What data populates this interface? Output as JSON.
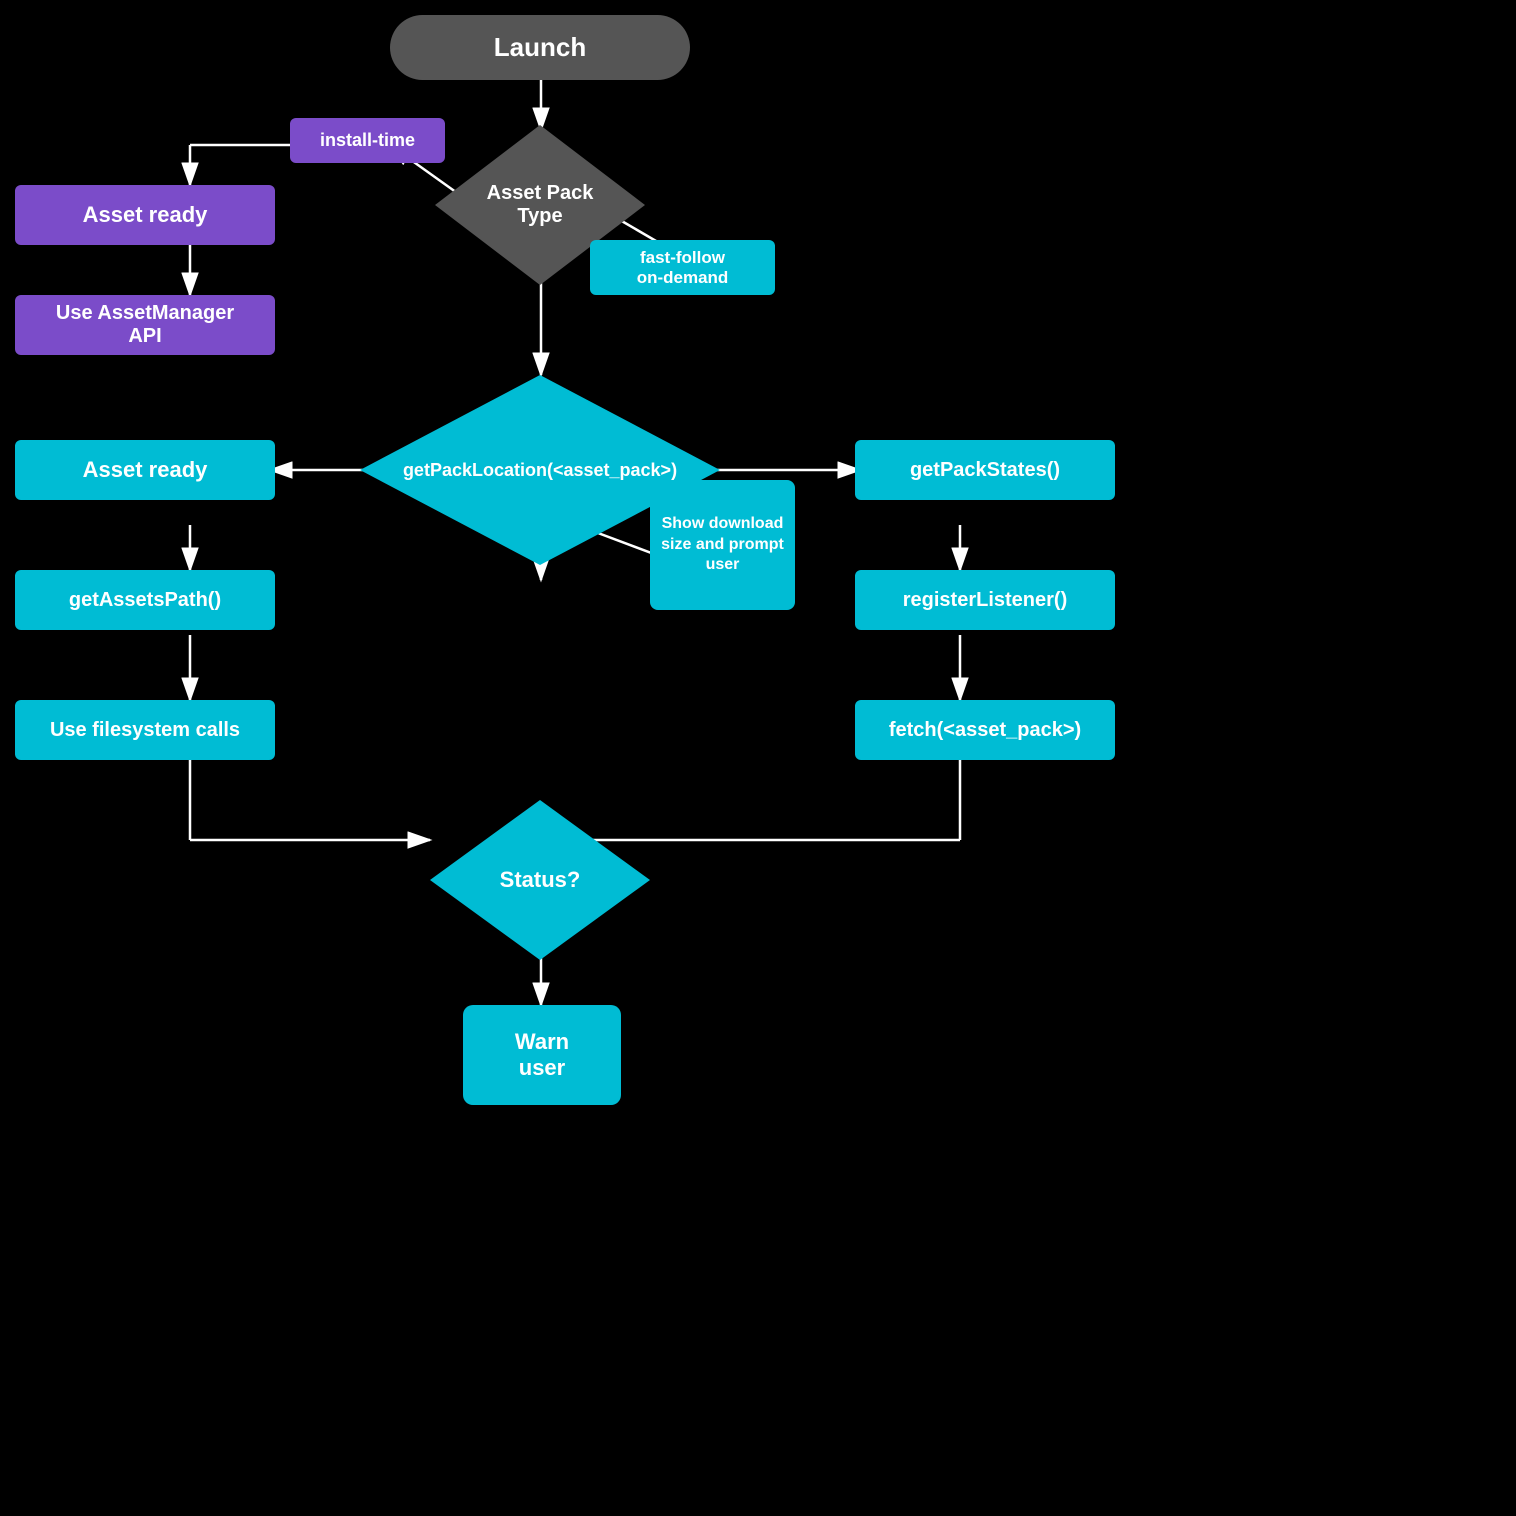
{
  "nodes": {
    "launch": {
      "label": "Launch"
    },
    "asset_pack_type": {
      "label": "Asset Pack\nType"
    },
    "install_time": {
      "label": "install-time"
    },
    "fast_follow_on_demand": {
      "label": "fast-follow\non-demand"
    },
    "asset_ready_top": {
      "label": "Asset ready"
    },
    "use_asset_manager": {
      "label": "Use AssetManager API"
    },
    "get_pack_location": {
      "label": "getPackLocation(<asset_pack>)"
    },
    "get_pack_states": {
      "label": "getPackStates()"
    },
    "asset_ready_mid": {
      "label": "Asset ready"
    },
    "show_download": {
      "label": "Show download size and prompt user"
    },
    "register_listener": {
      "label": "registerListener()"
    },
    "get_assets_path": {
      "label": "getAssetsPath()"
    },
    "fetch": {
      "label": "fetch(<asset_pack>)"
    },
    "use_filesystem": {
      "label": "Use filesystem calls"
    },
    "status": {
      "label": "Status?"
    },
    "warn_user": {
      "label": "Warn\nuser"
    }
  }
}
